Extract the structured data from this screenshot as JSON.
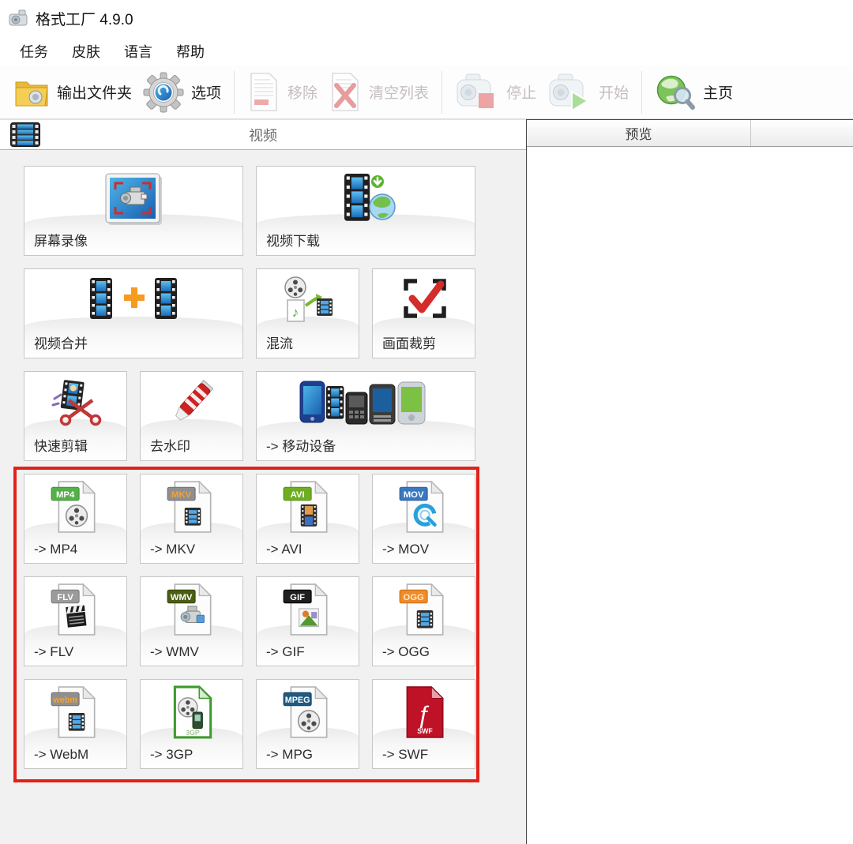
{
  "window": {
    "title": "格式工厂 4.9.0"
  },
  "menu": {
    "items": [
      {
        "label": "任务"
      },
      {
        "label": "皮肤"
      },
      {
        "label": "语言"
      },
      {
        "label": "帮助"
      }
    ]
  },
  "toolbar": {
    "output_folder_label": "输出文件夹",
    "options_label": "选项",
    "remove_label": "移除",
    "clear_list_label": "清空列表",
    "stop_label": "停止",
    "start_label": "开始",
    "home_label": "主页"
  },
  "left_panel": {
    "header_label": "视频"
  },
  "right_panel": {
    "preview_column_label": "预览"
  },
  "grid": {
    "buttons": [
      {
        "label": "屏幕录像"
      },
      {
        "label": "视频下载"
      },
      {
        "label": "视频合并"
      },
      {
        "label": "混流"
      },
      {
        "label": "画面裁剪"
      },
      {
        "label": "快速剪辑"
      },
      {
        "label": "去水印"
      },
      {
        "label": "-> 移动设备"
      },
      {
        "label": "-> MP4",
        "tag": "MP4"
      },
      {
        "label": "-> MKV",
        "tag": "MKV"
      },
      {
        "label": "-> AVI",
        "tag": "AVI"
      },
      {
        "label": "-> MOV",
        "tag": "MOV"
      },
      {
        "label": "-> FLV",
        "tag": "FLV"
      },
      {
        "label": "-> WMV",
        "tag": "WMV"
      },
      {
        "label": "-> GIF",
        "tag": "GIF"
      },
      {
        "label": "-> OGG",
        "tag": "OGG"
      },
      {
        "label": "-> WebM",
        "tag": "webm"
      },
      {
        "label": "-> 3GP",
        "tag": "3GP"
      },
      {
        "label": "-> MPG",
        "tag": "MPEG"
      },
      {
        "label": "-> SWF",
        "tag": "SWF"
      }
    ]
  },
  "glyphs": {
    "music_note": "♪",
    "flash_f": "ƒ"
  },
  "colors": {
    "highlight_box": "#e32119",
    "disabled_text": "#c6bebe",
    "enabled_text": "#1c1c1c",
    "film_blue": "#4fa8e8",
    "tag_mp4_green": "#55b04a",
    "tag_orange": "#ef8b28",
    "tag_blue": "#3a78be"
  }
}
